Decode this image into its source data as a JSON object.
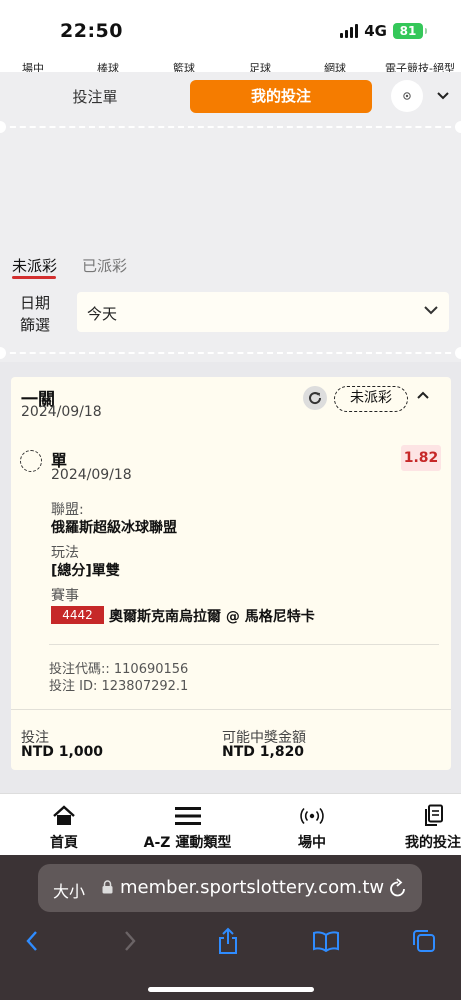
{
  "status_bar": {
    "time": "22:50",
    "network": "4G",
    "battery": "81"
  },
  "sport_tabs": [
    "場中",
    "棒球",
    "籃球",
    "足球",
    "網球",
    "電子競技-絕型"
  ],
  "header": {
    "betslip_tab": "投注單",
    "mybets_tab": "我的投注"
  },
  "subtabs": {
    "unsettled": "未派彩",
    "settled": "已派彩"
  },
  "date_filter": {
    "label": "日期\n篩選",
    "value": "今天"
  },
  "bet": {
    "title": "一關",
    "date": "2024/09/18",
    "status": "未派彩",
    "selection": {
      "type": "單",
      "date": "2024/09/18",
      "odds": "1.82",
      "league_label": "聯盟:",
      "league": "俄羅斯超級冰球聯盟",
      "market_label": "玩法",
      "market": "[總分]單雙",
      "event_label": "賽事",
      "event_id": "4442",
      "event": "奧爾斯克南烏拉爾 @ 馬格尼特卡"
    },
    "code": "投注代碼:: 110690156",
    "bet_id": "投注 ID: 123807292.1",
    "stake_label": "投注",
    "stake": "NTD 1,000",
    "payout_label": "可能中獎金額",
    "payout": "NTD 1,820"
  },
  "bottom_nav": [
    {
      "label": "首頁",
      "icon": "home-icon"
    },
    {
      "label": "A-Z 運動類型",
      "icon": "menu-icon"
    },
    {
      "label": "場中",
      "icon": "live-icon"
    },
    {
      "label": "我的投注",
      "icon": "copy-icon"
    }
  ],
  "browser": {
    "text_size": "大小",
    "url": "member.sportslottery.com.tw"
  }
}
